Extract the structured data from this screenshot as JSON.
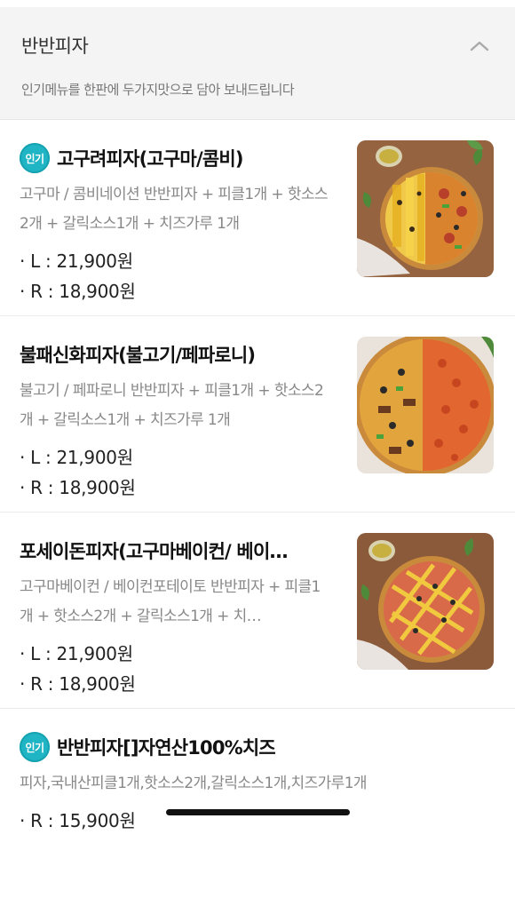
{
  "section": {
    "title": "반반피자",
    "description": "인기메뉴를 한판에 두가지맛으로 담아 보내드립니다",
    "collapse_icon": "chevron-up-icon"
  },
  "menu_items": [
    {
      "badge": "인기",
      "name": "고구려피자(고구마/콤비)",
      "description": "고구마 / 콤비네이션 반반피자 + 피클1개 + 핫소스2개 + 갈릭소스1개 + 치즈가루 1개",
      "prices": [
        "· L : 21,900원",
        "· R : 18,900원"
      ],
      "image": "half-sweet-potato-half-combination-pizza"
    },
    {
      "badge": "",
      "name": "불패신화피자(불고기/페파로니)",
      "description": "불고기 / 페파로니 반반피자 + 피클1개 + 핫소스2개 + 갈릭소스1개 + 치즈가루 1개",
      "prices": [
        "· L : 21,900원",
        "· R : 18,900원"
      ],
      "image": "half-bulgogi-half-pepperoni-pizza"
    },
    {
      "badge": "",
      "name": "포세이돈피자(고구마베이컨/ 베이…",
      "description": "고구마베이컨 / 베이컨포테이토 반반피자 + 피클1개 + 핫소스2개 + 갈릭소스1개 + 치…",
      "prices": [
        "· L : 21,900원",
        "· R : 18,900원"
      ],
      "image": "half-sweet-potato-bacon-half-bacon-potato-pizza"
    },
    {
      "badge": "인기",
      "name": "반반피자[]자연산100%치즈",
      "description": "피자,국내산피클1개,핫소스2개,갈릭소스1개,치즈가루1개",
      "prices": [
        "· R : 15,900원"
      ],
      "image": ""
    }
  ],
  "colors": {
    "badge": "#1fb5c4",
    "header_bg": "#f4f4f5",
    "price_text": "#222222",
    "description_text": "#888888"
  }
}
